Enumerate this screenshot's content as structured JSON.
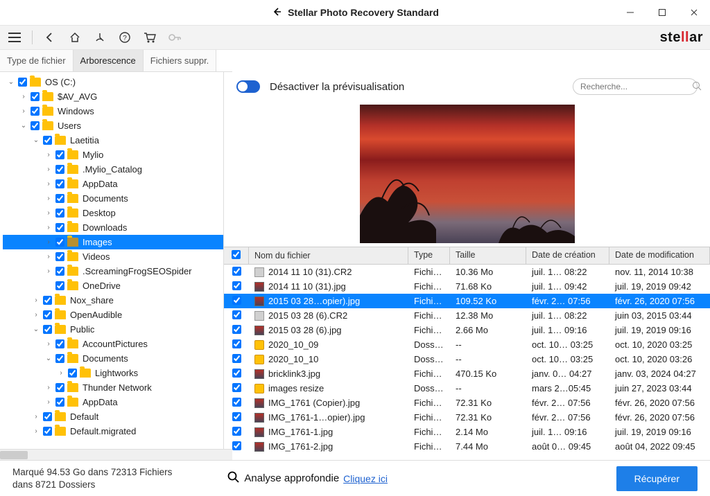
{
  "app": {
    "title": "Stellar Photo Recovery Standard"
  },
  "brand": {
    "prefix": "ste",
    "mid": "ll",
    "suffix": "ar"
  },
  "tabs": {
    "fileType": "Type de fichier",
    "tree": "Arborescence",
    "deleted": "Fichiers suppr."
  },
  "preview": {
    "toggleLabel": "Désactiver la prévisualisation",
    "searchPlaceholder": "Recherche..."
  },
  "tree": [
    {
      "level": 1,
      "caret": "v",
      "label": "OS (C:)"
    },
    {
      "level": 2,
      "caret": ">",
      "label": "$AV_AVG"
    },
    {
      "level": 2,
      "caret": ">",
      "label": "Windows"
    },
    {
      "level": 2,
      "caret": "v",
      "label": "Users"
    },
    {
      "level": 3,
      "caret": "v",
      "label": "Laetitia"
    },
    {
      "level": 4,
      "caret": ">",
      "label": "Mylio"
    },
    {
      "level": 4,
      "caret": ">",
      "label": ".Mylio_Catalog"
    },
    {
      "level": 4,
      "caret": ">",
      "label": "AppData"
    },
    {
      "level": 4,
      "caret": ">",
      "label": "Documents"
    },
    {
      "level": 4,
      "caret": ">",
      "label": "Desktop"
    },
    {
      "level": 4,
      "caret": ">",
      "label": "Downloads"
    },
    {
      "level": 4,
      "caret": ">",
      "label": "Images",
      "selected": true
    },
    {
      "level": 4,
      "caret": ">",
      "label": "Videos"
    },
    {
      "level": 4,
      "caret": ">",
      "label": ".ScreamingFrogSEOSpider"
    },
    {
      "level": 4,
      "caret": "",
      "label": "OneDrive"
    },
    {
      "level": 3,
      "caret": ">",
      "label": "Nox_share"
    },
    {
      "level": 3,
      "caret": ">",
      "label": "OpenAudible"
    },
    {
      "level": 3,
      "caret": "v",
      "label": "Public"
    },
    {
      "level": 4,
      "caret": ">",
      "label": "AccountPictures"
    },
    {
      "level": 4,
      "caret": "v",
      "label": "Documents"
    },
    {
      "level": 5,
      "caret": ">",
      "label": "Lightworks"
    },
    {
      "level": 4,
      "caret": ">",
      "label": "Thunder Network"
    },
    {
      "level": 4,
      "caret": ">",
      "label": "AppData"
    },
    {
      "level": 3,
      "caret": ">",
      "label": "Default"
    },
    {
      "level": 3,
      "caret": ">",
      "label": "Default.migrated"
    }
  ],
  "columns": {
    "name": "Nom du fichier",
    "type": "Type",
    "size": "Taille",
    "created": "Date de création",
    "modified": "Date de modification"
  },
  "files": [
    {
      "icon": "doc",
      "name": "2014 11 10 (31).CR2",
      "type": "Fichiers",
      "size": "10.36 Mo",
      "created": "juil. 1… 08:22",
      "modified": "nov. 11, 2014 10:38"
    },
    {
      "icon": "img",
      "name": "2014 11 10 (31).jpg",
      "type": "Fichiers",
      "size": "71.68 Ko",
      "created": "juil. 1… 09:42",
      "modified": "juil. 19, 2019 09:42"
    },
    {
      "icon": "img",
      "name": "2015 03 28…opier).jpg",
      "type": "Fichiers",
      "size": "109.52 Ko",
      "created": "févr. 2… 07:56",
      "modified": "févr. 26, 2020 07:56",
      "selected": true
    },
    {
      "icon": "doc",
      "name": "2015 03 28 (6).CR2",
      "type": "Fichiers",
      "size": "12.38 Mo",
      "created": "juil. 1… 08:22",
      "modified": "juin 03, 2015 03:44"
    },
    {
      "icon": "img",
      "name": "2015 03 28 (6).jpg",
      "type": "Fichiers",
      "size": "2.66 Mo",
      "created": "juil. 1… 09:16",
      "modified": "juil. 19, 2019 09:16"
    },
    {
      "icon": "fold",
      "name": "2020_10_09",
      "type": "Dossier",
      "size": "--",
      "created": "oct. 10… 03:25",
      "modified": "oct. 10, 2020 03:25"
    },
    {
      "icon": "fold",
      "name": "2020_10_10",
      "type": "Dossier",
      "size": "--",
      "created": "oct. 10… 03:25",
      "modified": "oct. 10, 2020 03:26"
    },
    {
      "icon": "img",
      "name": "bricklink3.jpg",
      "type": "Fichiers",
      "size": "470.15 Ko",
      "created": "janv. 0… 04:27",
      "modified": "janv. 03, 2024 04:27"
    },
    {
      "icon": "fold",
      "name": "images resize",
      "type": "Dossier",
      "size": "--",
      "created": "mars 2…05:45",
      "modified": "juin 27, 2023 03:44"
    },
    {
      "icon": "img",
      "name": "IMG_1761 (Copier).jpg",
      "type": "Fichiers",
      "size": "72.31 Ko",
      "created": "févr. 2… 07:56",
      "modified": "févr. 26, 2020 07:56"
    },
    {
      "icon": "img",
      "name": "IMG_1761-1…opier).jpg",
      "type": "Fichiers",
      "size": "72.31 Ko",
      "created": "févr. 2… 07:56",
      "modified": "févr. 26, 2020 07:56"
    },
    {
      "icon": "img",
      "name": "IMG_1761-1.jpg",
      "type": "Fichiers",
      "size": "2.14 Mo",
      "created": "juil. 1… 09:16",
      "modified": "juil. 19, 2019 09:16"
    },
    {
      "icon": "img",
      "name": "IMG_1761-2.jpg",
      "type": "Fichiers",
      "size": "7.44 Mo",
      "created": "août 0… 09:45",
      "modified": "août 04, 2022 09:45"
    }
  ],
  "footer": {
    "status1": "Marqué 94.53 Go dans 72313 Fichiers",
    "status2": "dans 8721 Dossiers",
    "deepScan": "Analyse approfondie",
    "deepLink": "Cliquez ici",
    "recover": "Récupérer"
  }
}
